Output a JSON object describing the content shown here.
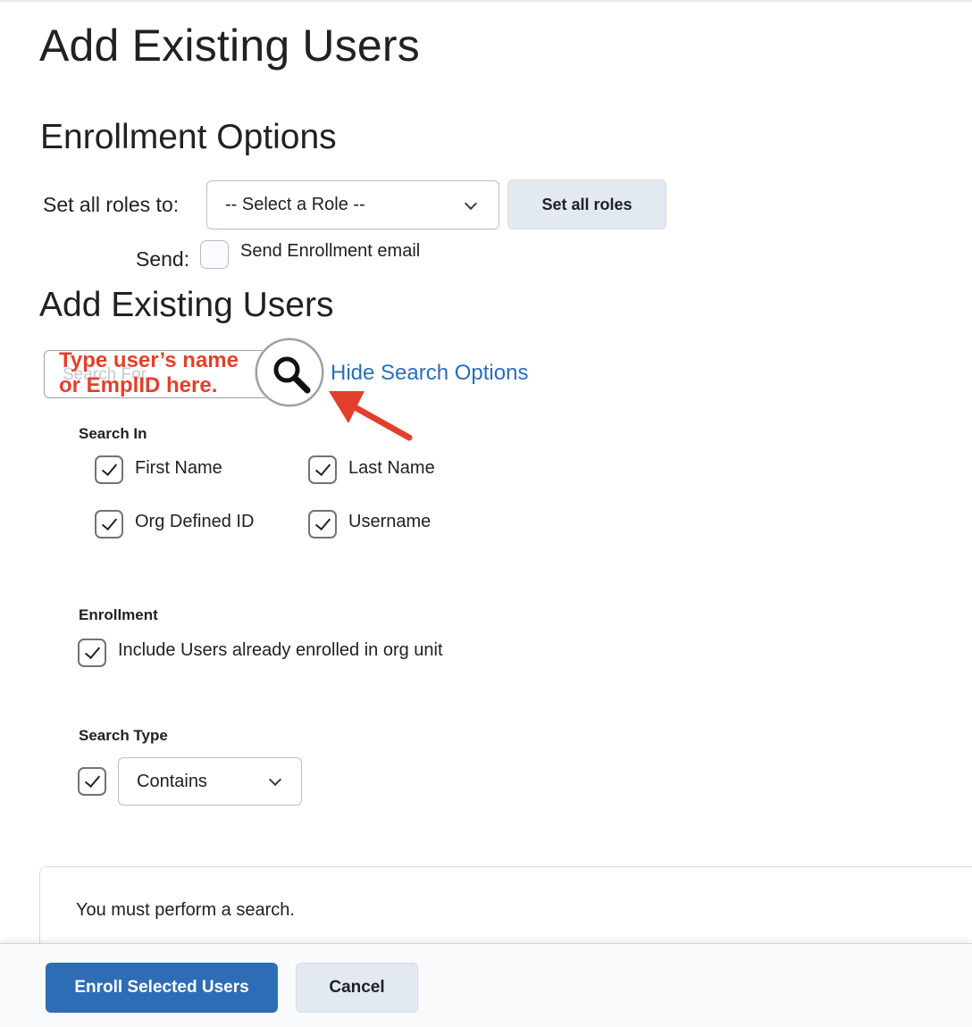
{
  "page": {
    "title": "Add Existing Users"
  },
  "enrollment_options": {
    "heading": "Enrollment Options",
    "roles_label": "Set all roles to:",
    "role_select_value": "-- Select a Role --",
    "set_roles_button": "Set all roles",
    "send_label": "Send:",
    "send_checkbox_label": "Send Enrollment email",
    "send_checked": false
  },
  "add_users": {
    "heading": "Add Existing Users",
    "search_placeholder": "Search For...",
    "annotation_line1": "Type user’s name",
    "annotation_line2": "or EmplID here.",
    "search_icon": "search-icon",
    "hide_link": "Hide Search Options"
  },
  "search_in": {
    "label": "Search In",
    "options": [
      {
        "label": "First Name",
        "checked": true
      },
      {
        "label": "Last Name",
        "checked": true
      },
      {
        "label": "Org Defined ID",
        "checked": true
      },
      {
        "label": "Username",
        "checked": true
      }
    ]
  },
  "enrollment": {
    "label": "Enrollment",
    "option_label": "Include Users already enrolled in org unit",
    "checked": true
  },
  "search_type": {
    "label": "Search Type",
    "checked": true,
    "select_value": "Contains"
  },
  "results": {
    "message": "You must perform a search."
  },
  "footer": {
    "enroll_button": "Enroll Selected Users",
    "cancel_button": "Cancel"
  },
  "colors": {
    "primary": "#2e6db5",
    "link": "#2a6ebb",
    "annotation": "#e2402c"
  }
}
